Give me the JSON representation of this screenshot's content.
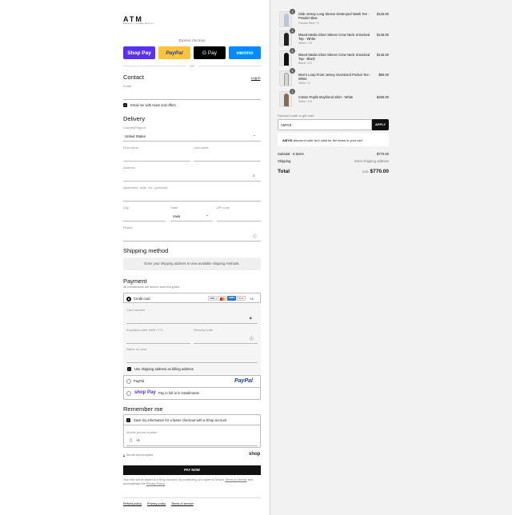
{
  "brand": {
    "logo": "ATM",
    "tagline": "ANTHONY THOMAS MELILLO"
  },
  "express": {
    "title": "Express checkout",
    "or": "OR",
    "buttons": [
      {
        "label": "Shop Pay",
        "color": "#5a31f4"
      },
      {
        "label": "PayPal",
        "color": "#ffc439"
      },
      {
        "label": "G Pay",
        "color": "#000000"
      },
      {
        "label": "venmo",
        "color": "#008cff"
      }
    ]
  },
  "contact": {
    "heading": "Contact",
    "login": "Log in",
    "email_label": "Email",
    "news_label": "Email me with news and offers"
  },
  "delivery": {
    "heading": "Delivery",
    "country_label": "Country/Region",
    "country_value": "United States",
    "first_name": "First name",
    "last_name": "Last name",
    "address": "Address",
    "apartment": "Apartment, suite, etc. (optional)",
    "city": "City",
    "state_label": "State",
    "state_value": "Iowa",
    "zip": "ZIP code",
    "phone": "Phone"
  },
  "shipping": {
    "heading": "Shipping method",
    "note": "Enter your shipping address to view available shipping methods."
  },
  "payment": {
    "heading": "Payment",
    "subtitle": "All transactions are secure and encrypted.",
    "credit_card": "Credit card",
    "card_logos": [
      "visa",
      "mc",
      "amex",
      "discover"
    ],
    "more_cards": "+4",
    "card_number": "Card number",
    "expiry": "Expiration date (MM / YY)",
    "security": "Security code",
    "name_on_card": "Name on card",
    "billing_same": "Use shipping address as billing address",
    "paypal": "PayPal",
    "paypal_logo": "PayPal",
    "shoppay_logo": "shop Pay",
    "shoppay_label": "Pay in full or in installments"
  },
  "remember": {
    "heading": "Remember me",
    "save_label": "Save my information for a faster checkout with a Shop account",
    "mobile_label": "Mobile phone number",
    "mobile_prefix": "+1",
    "secure": "Secure and encrypted",
    "shop_logo": "shop"
  },
  "pay_now": "PAY NOW",
  "legal": {
    "text": "Your info will be saved to a Shop account. By continuing, you agree to Shop's",
    "terms": "Terms of Service",
    "and": "and acknowledge the",
    "privacy": "Privacy Policy."
  },
  "footer": {
    "refund": "Refund policy",
    "privacy": "Privacy policy",
    "terms": "Terms of service"
  },
  "cart": {
    "items": [
      {
        "qty": "1",
        "name": "Slub Jersey Long Sleeve Destroyed Wash Tee - Powder Blue",
        "variant": "Powder Blue / S",
        "price": "$125.00",
        "color": "#b9c7d6"
      },
      {
        "qty": "1",
        "name": "Mixed Media Short Sleeve Crew Neck Smocked Top - White",
        "variant": "White / XS",
        "price": "$145.00",
        "color": "#222222"
      },
      {
        "qty": "1",
        "name": "Mixed Media Short Sleeve Crew Neck Smocked Top - Black",
        "variant": "Black / XS",
        "price": "$145.00",
        "color": "#111111"
      },
      {
        "qty": "1",
        "name": "Men's Loop Front Jersey Oversized Pocket Tee - White",
        "variant": "White / S",
        "price": "$90.00",
        "color": "#d8d4cc"
      },
      {
        "qty": "1",
        "name": "Cotton Poplin Boyfriend Shirt - White",
        "variant": "White / XS",
        "price": "$265.00",
        "color": "#8a6b55"
      }
    ],
    "discount_label": "Discount code or gift card",
    "discount_value": "AMYIS",
    "apply": "APPLY",
    "error_code": "AMYIS",
    "error_text": "discount code isn't valid for the items in your cart",
    "subtotal_label": "Subtotal · 5 items",
    "subtotal_value": "$770.00",
    "shipping_label": "Shipping",
    "shipping_value": "Enter shipping address",
    "total_label": "Total",
    "currency": "USD",
    "total_value": "$770.00"
  }
}
